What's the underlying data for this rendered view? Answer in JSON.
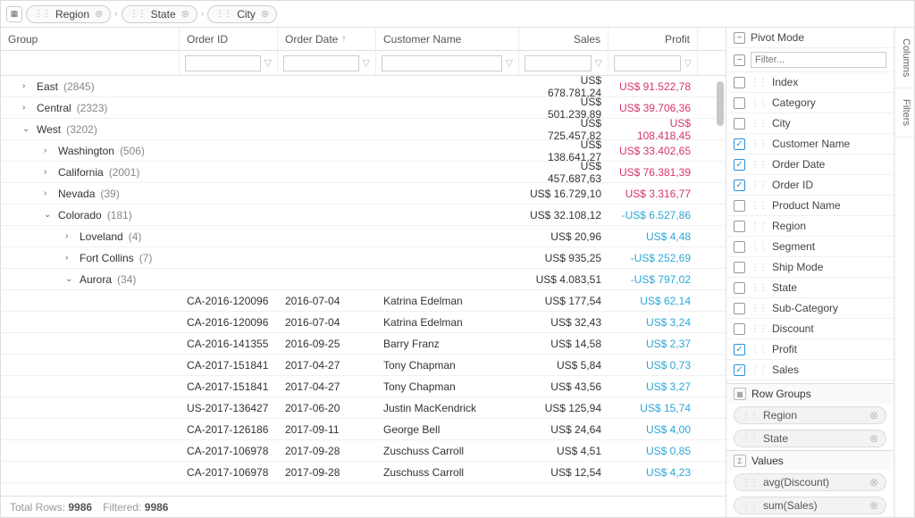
{
  "breadcrumb": {
    "items": [
      {
        "label": "Region"
      },
      {
        "label": "State"
      },
      {
        "label": "City"
      }
    ]
  },
  "columns": {
    "group": "Group",
    "order_id": "Order ID",
    "order_date": "Order Date",
    "customer": "Customer Name",
    "sales": "Sales",
    "profit": "Profit"
  },
  "rows": [
    {
      "type": "group",
      "level": 0,
      "expanded": false,
      "label": "East",
      "count": "(2845)",
      "sales": "US$ 678.781,24",
      "profit": "US$ 91.522,78",
      "pclass": "pos"
    },
    {
      "type": "group",
      "level": 0,
      "expanded": false,
      "label": "Central",
      "count": "(2323)",
      "sales": "US$ 501.239,89",
      "profit": "US$ 39.706,36",
      "pclass": "pos"
    },
    {
      "type": "group",
      "level": 0,
      "expanded": true,
      "label": "West",
      "count": "(3202)",
      "sales": "US$ 725.457,82",
      "profit": "US$ 108.418,45",
      "pclass": "pos"
    },
    {
      "type": "group",
      "level": 1,
      "expanded": false,
      "label": "Washington",
      "count": "(506)",
      "sales": "US$ 138.641,27",
      "profit": "US$ 33.402,65",
      "pclass": "pos"
    },
    {
      "type": "group",
      "level": 1,
      "expanded": false,
      "label": "California",
      "count": "(2001)",
      "sales": "US$ 457.687,63",
      "profit": "US$ 76.381,39",
      "pclass": "pos"
    },
    {
      "type": "group",
      "level": 1,
      "expanded": false,
      "label": "Nevada",
      "count": "(39)",
      "sales": "US$ 16.729,10",
      "profit": "US$ 3.316,77",
      "pclass": "pos"
    },
    {
      "type": "group",
      "level": 1,
      "expanded": true,
      "label": "Colorado",
      "count": "(181)",
      "sales": "US$ 32.108,12",
      "profit": "-US$ 6.527,86",
      "pclass": "neg"
    },
    {
      "type": "group",
      "level": 2,
      "expanded": false,
      "label": "Loveland",
      "count": "(4)",
      "sales": "US$ 20,96",
      "profit": "US$ 4,48",
      "pclass": "neg"
    },
    {
      "type": "group",
      "level": 2,
      "expanded": false,
      "label": "Fort Collins",
      "count": "(7)",
      "sales": "US$ 935,25",
      "profit": "-US$ 252,69",
      "pclass": "neg"
    },
    {
      "type": "group",
      "level": 2,
      "expanded": true,
      "label": "Aurora",
      "count": "(34)",
      "sales": "US$ 4.083,51",
      "profit": "-US$ 797,02",
      "pclass": "neg"
    },
    {
      "type": "data",
      "order_id": "CA-2016-120096",
      "order_date": "2016-07-04",
      "customer": "Katrina Edelman",
      "sales": "US$ 177,54",
      "profit": "US$ 62,14",
      "pclass": "neg"
    },
    {
      "type": "data",
      "order_id": "CA-2016-120096",
      "order_date": "2016-07-04",
      "customer": "Katrina Edelman",
      "sales": "US$ 32,43",
      "profit": "US$ 3,24",
      "pclass": "neg"
    },
    {
      "type": "data",
      "order_id": "CA-2016-141355",
      "order_date": "2016-09-25",
      "customer": "Barry Franz",
      "sales": "US$ 14,58",
      "profit": "US$ 2,37",
      "pclass": "neg"
    },
    {
      "type": "data",
      "order_id": "CA-2017-151841",
      "order_date": "2017-04-27",
      "customer": "Tony Chapman",
      "sales": "US$ 5,84",
      "profit": "US$ 0,73",
      "pclass": "neg"
    },
    {
      "type": "data",
      "order_id": "CA-2017-151841",
      "order_date": "2017-04-27",
      "customer": "Tony Chapman",
      "sales": "US$ 43,56",
      "profit": "US$ 3,27",
      "pclass": "neg"
    },
    {
      "type": "data",
      "order_id": "US-2017-136427",
      "order_date": "2017-06-20",
      "customer": "Justin MacKendrick",
      "sales": "US$ 125,94",
      "profit": "US$ 15,74",
      "pclass": "neg"
    },
    {
      "type": "data",
      "order_id": "CA-2017-126186",
      "order_date": "2017-09-11",
      "customer": "George Bell",
      "sales": "US$ 24,64",
      "profit": "US$ 4,00",
      "pclass": "neg"
    },
    {
      "type": "data",
      "order_id": "CA-2017-106978",
      "order_date": "2017-09-28",
      "customer": "Zuschuss Carroll",
      "sales": "US$ 4,51",
      "profit": "US$ 0,85",
      "pclass": "neg"
    },
    {
      "type": "data",
      "order_id": "CA-2017-106978",
      "order_date": "2017-09-28",
      "customer": "Zuschuss Carroll",
      "sales": "US$ 12,54",
      "profit": "US$ 4,23",
      "pclass": "neg"
    }
  ],
  "status": {
    "total_label": "Total Rows:",
    "total_value": "9986",
    "filtered_label": "Filtered:",
    "filtered_value": "9986"
  },
  "sidebar": {
    "pivot_label": "Pivot Mode",
    "filter_placeholder": "Filter...",
    "fields": [
      {
        "label": "Index",
        "checked": false
      },
      {
        "label": "Category",
        "checked": false
      },
      {
        "label": "City",
        "checked": false
      },
      {
        "label": "Customer Name",
        "checked": true
      },
      {
        "label": "Order Date",
        "checked": true
      },
      {
        "label": "Order ID",
        "checked": true
      },
      {
        "label": "Product Name",
        "checked": false
      },
      {
        "label": "Region",
        "checked": false
      },
      {
        "label": "Segment",
        "checked": false
      },
      {
        "label": "Ship Mode",
        "checked": false
      },
      {
        "label": "State",
        "checked": false
      },
      {
        "label": "Sub-Category",
        "checked": false
      },
      {
        "label": "Discount",
        "checked": false
      },
      {
        "label": "Profit",
        "checked": true
      },
      {
        "label": "Sales",
        "checked": true
      }
    ],
    "row_groups_label": "Row Groups",
    "row_groups": [
      {
        "label": "Region"
      },
      {
        "label": "State"
      }
    ],
    "values_label": "Values",
    "values": [
      {
        "label": "avg(Discount)"
      },
      {
        "label": "sum(Sales)"
      }
    ],
    "tabs": {
      "columns": "Columns",
      "filters": "Filters"
    }
  }
}
